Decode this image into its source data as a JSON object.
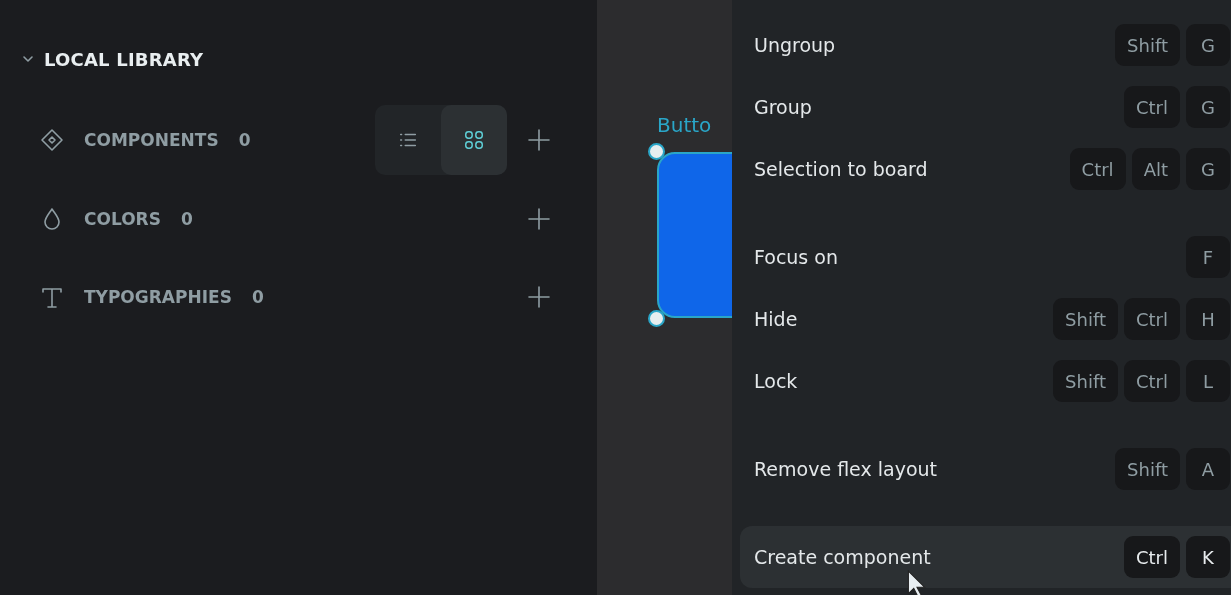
{
  "library": {
    "title": "LOCAL LIBRARY",
    "expanded": true,
    "sections": [
      {
        "kind": "components",
        "label": "COMPONENTS",
        "count": "0",
        "view_toggle": [
          {
            "kind": "list",
            "selected": false
          },
          {
            "kind": "grid",
            "selected": true
          }
        ]
      },
      {
        "kind": "colors",
        "label": "COLORS",
        "count": "0"
      },
      {
        "kind": "typographies",
        "label": "TYPOGRAPHIES",
        "count": "0"
      }
    ]
  },
  "canvas": {
    "layer_label": "Butto"
  },
  "context_menu": {
    "groups": [
      [
        {
          "label": "Ungroup",
          "keys": [
            "Shift",
            "G"
          ],
          "selected": false
        },
        {
          "label": "Group",
          "keys": [
            "Ctrl",
            "G"
          ],
          "selected": false
        },
        {
          "label": "Selection to board",
          "keys": [
            "Ctrl",
            "Alt",
            "G"
          ],
          "selected": false
        }
      ],
      [
        {
          "label": "Focus on",
          "keys": [
            "F"
          ],
          "selected": false
        },
        {
          "label": "Hide",
          "keys": [
            "Shift",
            "Ctrl",
            "H"
          ],
          "selected": false
        },
        {
          "label": "Lock",
          "keys": [
            "Shift",
            "Ctrl",
            "L"
          ],
          "selected": false
        }
      ],
      [
        {
          "label": "Remove flex layout",
          "keys": [
            "Shift",
            "A"
          ],
          "selected": false
        }
      ],
      [
        {
          "label": "Create component",
          "keys": [
            "Ctrl",
            "K"
          ],
          "selected": true
        }
      ]
    ]
  }
}
